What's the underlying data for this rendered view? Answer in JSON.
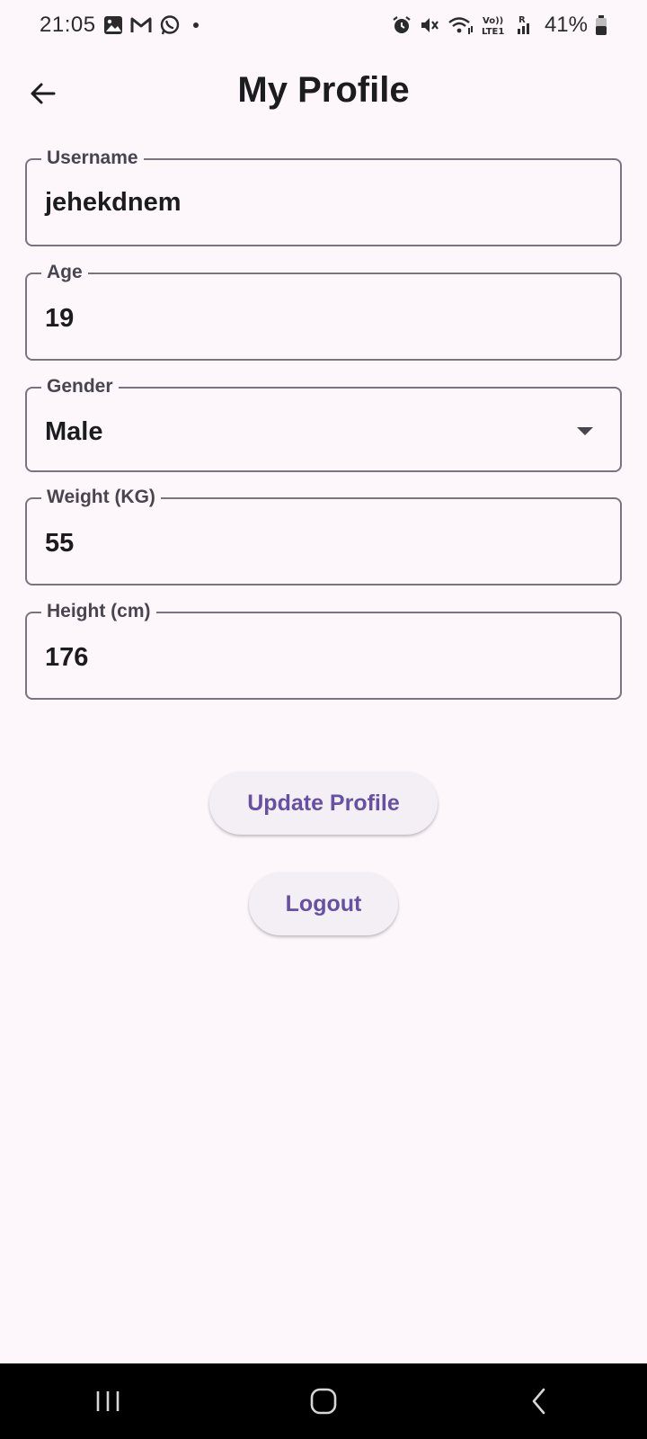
{
  "status_bar": {
    "time": "21:05",
    "battery": "41%",
    "icons_left": [
      "gallery-icon",
      "gmail-icon",
      "whatsapp-icon"
    ],
    "icons_right": [
      "alarm-icon",
      "mute-icon",
      "wifi-icon",
      "volte-lte-icon",
      "signal-icon",
      "battery-icon"
    ]
  },
  "app_bar": {
    "title": "My Profile",
    "back_icon": "arrow-left-icon"
  },
  "form": {
    "username": {
      "label": "Username",
      "value": "jehekdnem"
    },
    "age": {
      "label": "Age",
      "value": "19"
    },
    "gender": {
      "label": "Gender",
      "value": "Male",
      "icon": "dropdown-arrow-icon"
    },
    "weight": {
      "label": "Weight (KG)",
      "value": "55"
    },
    "height": {
      "label": "Height (cm)",
      "value": "176"
    }
  },
  "actions": {
    "update_label": "Update Profile",
    "logout_label": "Logout"
  },
  "nav_bar": {
    "items": [
      "recents-icon",
      "home-icon",
      "back-icon"
    ]
  },
  "colors": {
    "background": "#fdf7fc",
    "accent": "#6750a4",
    "outline": "#79747e",
    "button_bg": "#f3eff4"
  }
}
